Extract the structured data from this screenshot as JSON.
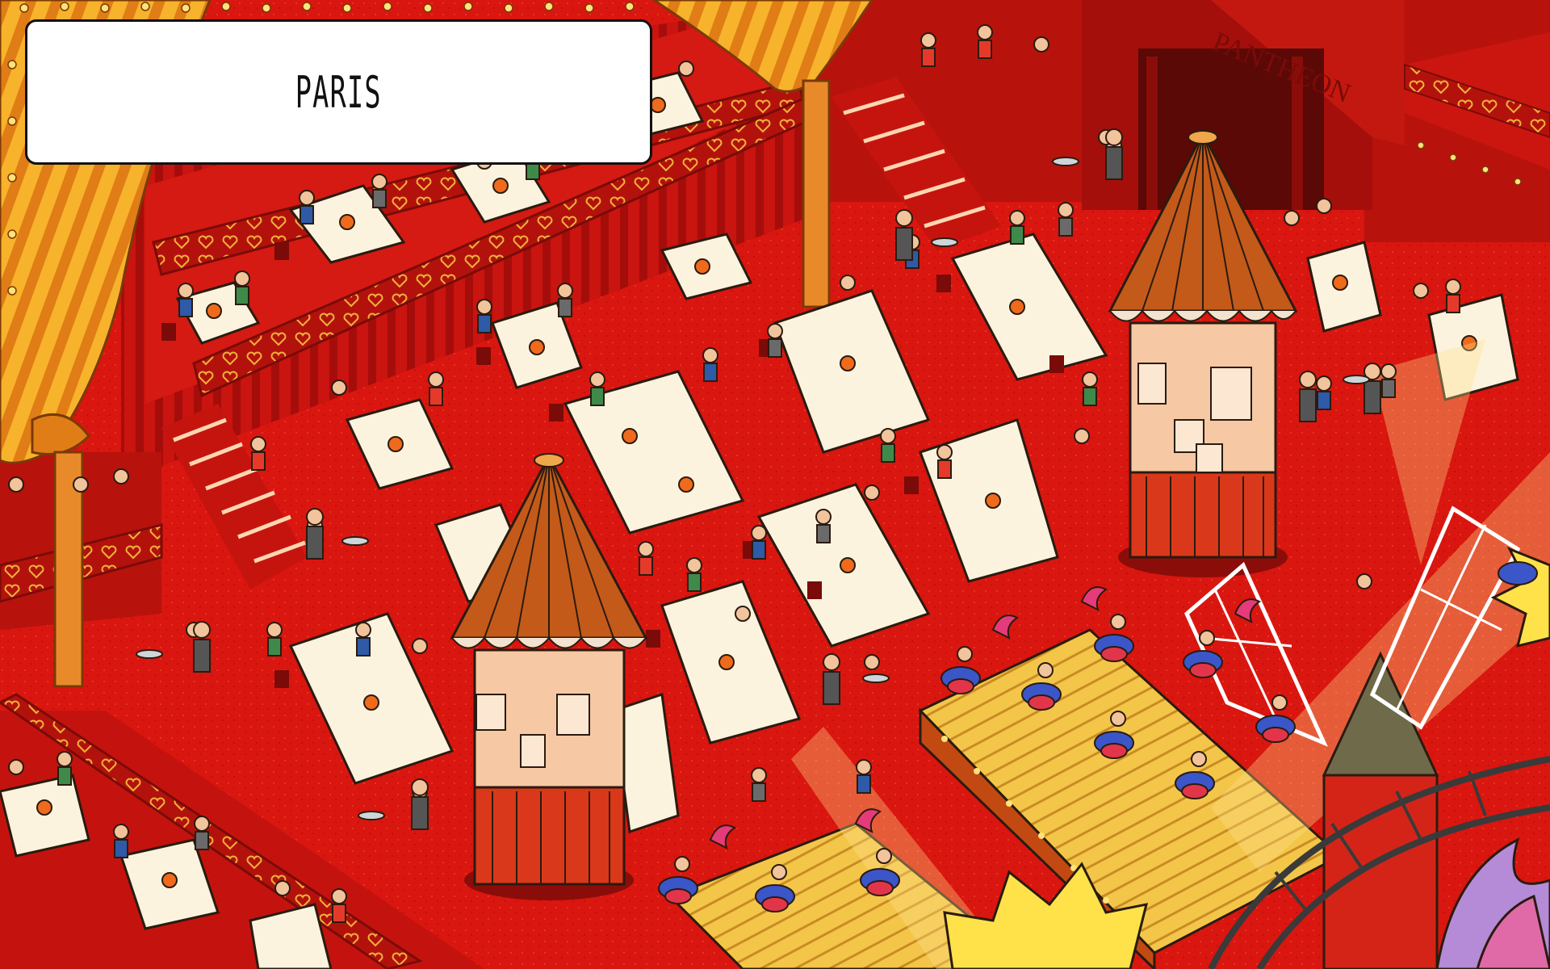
{
  "level": {
    "title": "PARIS"
  },
  "scene": {
    "description_icon": "cabaret-scene",
    "theater_sign": "PANTHEON",
    "colors": {
      "floor": "#d9160f",
      "wall": "#c8140f",
      "curtain": "#f4a21e",
      "stage": "#f3c64a",
      "tablecloth": "#fbf3de",
      "rail_gold": "#e9a93a"
    }
  }
}
